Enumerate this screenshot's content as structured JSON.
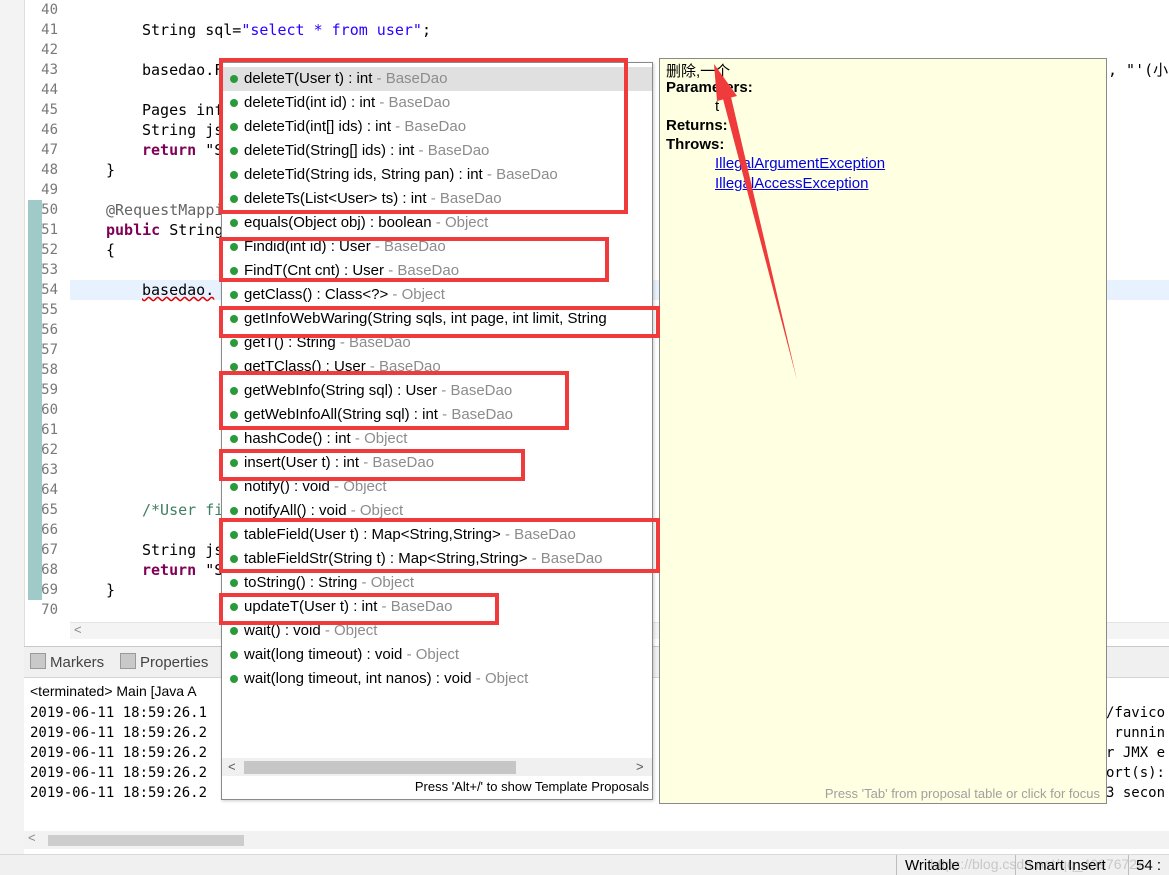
{
  "editor": {
    "line_numbers": [
      "40",
      "41",
      "42",
      "43",
      "44",
      "45",
      "46",
      "47",
      "48",
      "49",
      "50",
      "51",
      "52",
      "53",
      "54",
      "55",
      "56",
      "57",
      "58",
      "59",
      "60",
      "61",
      "62",
      "63",
      "64",
      "65",
      "66",
      "67",
      "68",
      "69",
      "70"
    ],
    "code": {
      "l41_kw": "String sql=",
      "l41_str": "\"select * from user\"",
      "l41_end": ";",
      "l43": "basedao.F",
      "l43_right": ", \"'(小",
      "l45_kw": "Pages inf",
      "l46": "String js",
      "l47_kw": "return",
      "l47_rest": " \"S",
      "l48": "}",
      "l50": "@RequestMappi",
      "l51_kw": "public",
      "l51_rest": " String",
      "l52": "{",
      "l54": "basedao.",
      "l65": "/*User fi",
      "l67": "String js",
      "l68_kw": "return",
      "l68_rest": " \"S",
      "l69": "}"
    }
  },
  "completion": {
    "items": [
      {
        "sig": "deleteT(User t) : int",
        "type": " - BaseDao",
        "selected": true
      },
      {
        "sig": "deleteTid(int id) : int",
        "type": " - BaseDao"
      },
      {
        "sig": "deleteTid(int[] ids) : int",
        "type": " - BaseDao"
      },
      {
        "sig": "deleteTid(String[] ids) : int",
        "type": " - BaseDao"
      },
      {
        "sig": "deleteTid(String ids, String pan) : int",
        "type": " - BaseDao"
      },
      {
        "sig": "deleteTs(List<User> ts) : int",
        "type": " - BaseDao"
      },
      {
        "sig": "equals(Object obj) : boolean",
        "type": " - Object"
      },
      {
        "sig": "Findid(int id) : User",
        "type": " - BaseDao"
      },
      {
        "sig": "FindT(Cnt cnt) : User",
        "type": " - BaseDao"
      },
      {
        "sig": "getClass() : Class<?>",
        "type": " - Object"
      },
      {
        "sig": "getInfoWebWaring(String sqls, int page, int limit, String",
        "type": ""
      },
      {
        "sig": "getT() : String",
        "type": " - BaseDao"
      },
      {
        "sig": "getTClass() : User",
        "type": " - BaseDao"
      },
      {
        "sig": "getWebInfo(String sql) : User",
        "type": " - BaseDao"
      },
      {
        "sig": "getWebInfoAll(String sql) : int",
        "type": " - BaseDao"
      },
      {
        "sig": "hashCode() : int",
        "type": " - Object"
      },
      {
        "sig": "insert(User t) : int",
        "type": " - BaseDao"
      },
      {
        "sig": "notify() : void",
        "type": " - Object"
      },
      {
        "sig": "notifyAll() : void",
        "type": " - Object"
      },
      {
        "sig": "tableField(User t) : Map<String,String>",
        "type": " - BaseDao"
      },
      {
        "sig": "tableFieldStr(String t) : Map<String,String>",
        "type": " - BaseDao"
      },
      {
        "sig": "toString() : String",
        "type": " - Object"
      },
      {
        "sig": "updateT(User t) : int",
        "type": " - BaseDao"
      },
      {
        "sig": "wait() : void",
        "type": " - Object"
      },
      {
        "sig": "wait(long timeout) : void",
        "type": " - Object"
      },
      {
        "sig": "wait(long timeout, int nanos) : void",
        "type": " - Object"
      }
    ],
    "footer": "Press 'Alt+/' to show Template Proposals",
    "scroll_left": "<",
    "scroll_right": ">"
  },
  "javadoc": {
    "summary": "删除,一个",
    "parameters_label": "Parameters:",
    "param_name": "t",
    "returns_label": "Returns:",
    "throws_label": "Throws:",
    "throws": [
      "IllegalArgumentException",
      "IllegalAccessException"
    ],
    "footer": "Press 'Tab' from proposal table or click for focus"
  },
  "console": {
    "tabs": [
      "Markers",
      "Properties"
    ],
    "status": "<terminated> Main [Java A",
    "logs": [
      "2019-06-11 18:59:26.1",
      "2019-06-11 18:59:26.2",
      "2019-06-11 18:59:26.2",
      "2019-06-11 18:59:26.2",
      "2019-06-11 18:59:26.2"
    ],
    "logs_right": [
      "*/favico",
      "s runnin",
      "or JMX e",
      "ort(s):",
      "03 secon"
    ]
  },
  "statusbar": {
    "writable": "Writable",
    "insert_mode": "Smart Insert",
    "position": "54 :",
    "watermark": "https://blog.csdn.net/qq_40976722"
  },
  "colors": {
    "highlight_box": "#ef3b3b",
    "doc_background": "#ffffe1",
    "method_dot": "#2c9a3c"
  }
}
